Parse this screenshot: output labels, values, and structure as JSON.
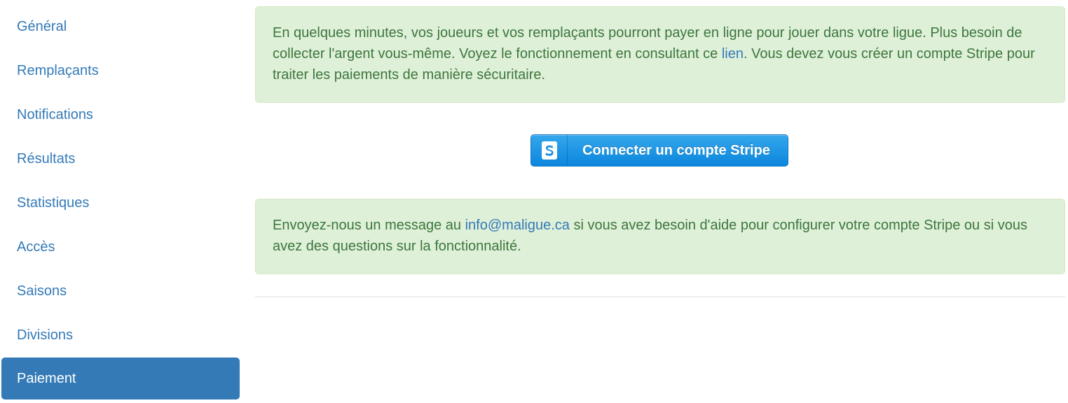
{
  "sidebar": {
    "items": [
      {
        "label": "Général",
        "active": false
      },
      {
        "label": "Remplaçants",
        "active": false
      },
      {
        "label": "Notifications",
        "active": false
      },
      {
        "label": "Résultats",
        "active": false
      },
      {
        "label": "Statistiques",
        "active": false
      },
      {
        "label": "Accès",
        "active": false
      },
      {
        "label": "Saisons",
        "active": false
      },
      {
        "label": "Divisions",
        "active": false
      },
      {
        "label": "Paiement",
        "active": true
      }
    ]
  },
  "main": {
    "info": {
      "text_before_link": "En quelques minutes, vos joueurs et vos remplaçants pourront payer en ligne pour jouer dans votre ligue. Plus besoin de collecter l'argent vous-même. Voyez le fonctionnement en consultant ce ",
      "link_label": "lien",
      "text_after_link": ". Vous devez vous créer un compte Stripe pour traiter les paiements de manière sécuritaire."
    },
    "stripe_button": {
      "icon": "stripe-s-icon",
      "label": "Connecter un compte Stripe"
    },
    "help": {
      "text_before_link": "Envoyez-nous un message au ",
      "email_label": "info@maligue.ca",
      "text_after_link": " si vous avez besoin d'aide pour configurer votre compte Stripe ou si vous avez des questions sur la fonctionnalité."
    }
  },
  "colors": {
    "link": "#337ab7",
    "active_bg": "#337ab7",
    "alert_bg": "#dff0d8",
    "alert_text": "#3c763d",
    "stripe_blue": "#1a8fe3"
  }
}
